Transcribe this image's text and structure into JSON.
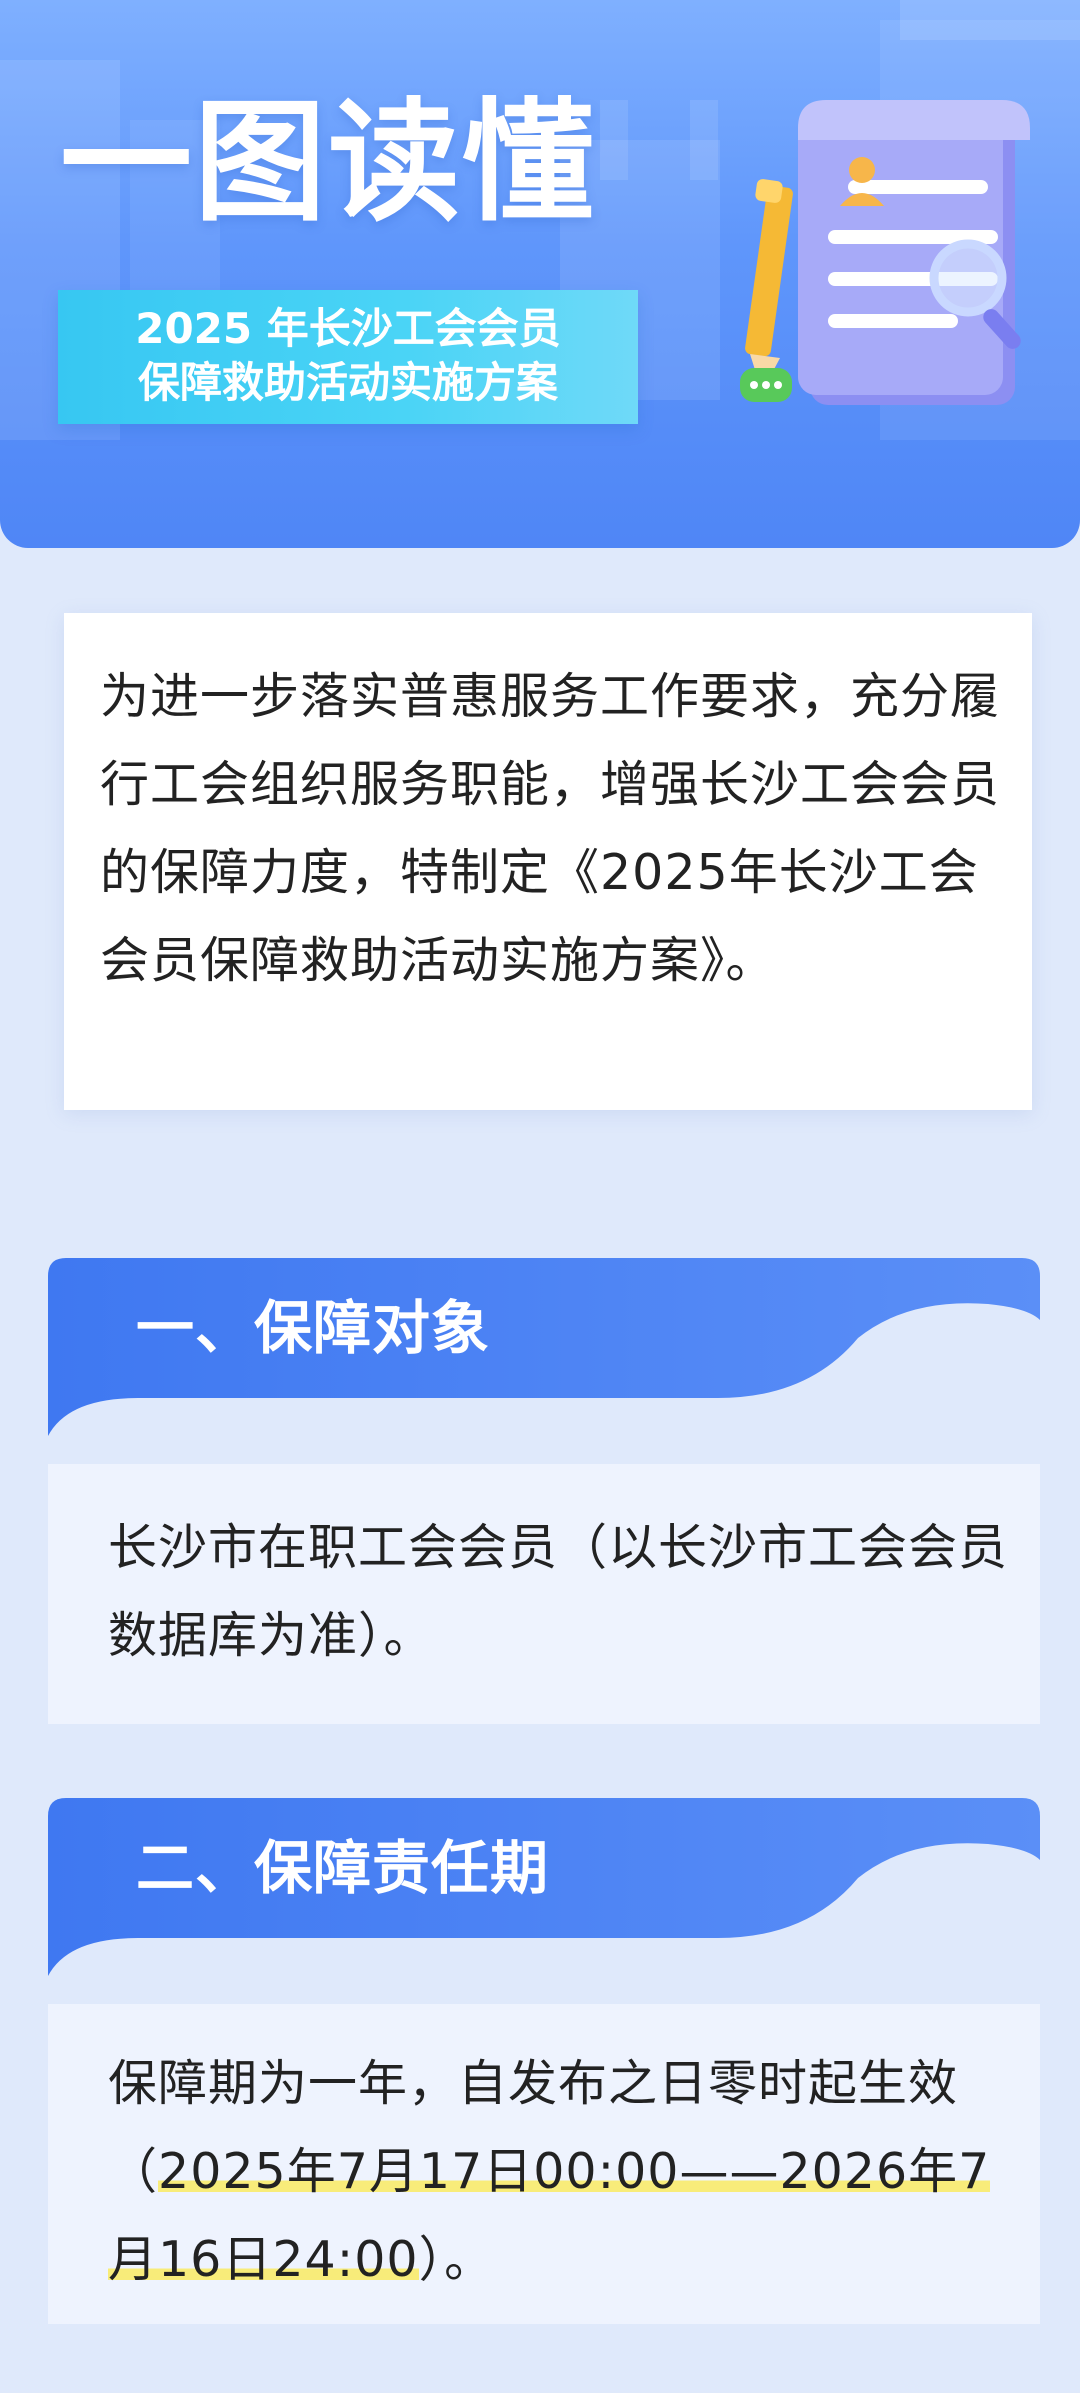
{
  "banner": {
    "title": "一图读懂",
    "subtitle_line1": "2025 年长沙工会会员",
    "subtitle_line2": "保障救助活动实施方案"
  },
  "intro": {
    "text": "为进一步落实普惠服务工作要求，充分履行工会组织服务职能，增强长沙工会会员的保障力度，特制定《2025年长沙工会会员保障救助活动实施方案》。"
  },
  "sections": [
    {
      "title": "一、保障对象",
      "text": "长沙市在职工会会员（以长沙市工会会员数据库为准）。"
    },
    {
      "title": "二、保障责任期",
      "text_before": "保障期为一年，自发布之日零时起生效（",
      "text_highlight": "2025年7月17日00:00——2026年7月16日24:00",
      "text_after": "）。"
    }
  ],
  "colors": {
    "banner_blue": "#5f96fb",
    "header_blue": "#4a80f3",
    "subtitle_cyan": "#37c7f2",
    "highlight_yellow": "#f8ec7a",
    "section_body": "#eef3fe"
  },
  "icons": [
    "document-scroll-icon",
    "pencil-icon",
    "magnifier-icon",
    "chat-bubble-icon",
    "person-icon"
  ]
}
